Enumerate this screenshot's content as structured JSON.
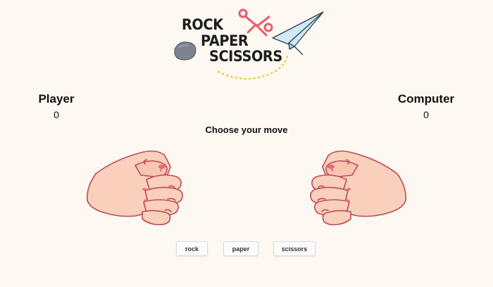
{
  "logo": {
    "line1": "ROCK",
    "line2": "PAPER",
    "line3": "SCISSORS",
    "colors": {
      "text": "#1e1e1e",
      "scissors": "#e85a6a",
      "plane": "#cfe9f6",
      "rock": "#7c828f",
      "dots": "#e8cc2f"
    }
  },
  "scoreboard": {
    "player_label": "Player",
    "player_score": "0",
    "computer_label": "Computer",
    "computer_score": "0"
  },
  "prompt": "Choose your move",
  "hands": {
    "player": "fist-icon",
    "computer": "fist-icon",
    "skin_color": "#f9d0bb",
    "outline_color": "#c0485a"
  },
  "moves": {
    "rock": "rock",
    "paper": "paper",
    "scissors": "scissors"
  }
}
